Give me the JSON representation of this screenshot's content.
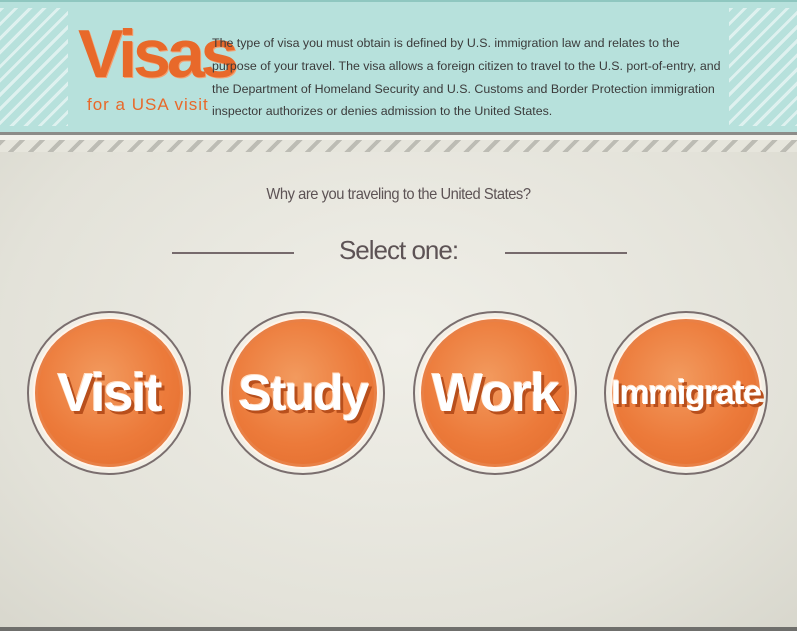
{
  "header": {
    "logo_title": "Visas",
    "logo_subtitle": "for a USA visit",
    "intro": "The type of visa you must obtain is defined by U.S. immigration law and relates to the purpose of your travel. The visa allows a foreign citizen to travel to the U.S. port-of-entry, and the Department of Homeland Security and U.S. Customs and Border Protection immigration inspector authorizes or denies admission to the United States."
  },
  "main": {
    "question": "Why are you traveling to the United States?",
    "select_label": "Select one:",
    "options": [
      {
        "label": "Visit"
      },
      {
        "label": "Study"
      },
      {
        "label": "Work"
      },
      {
        "label": "Immigrate"
      }
    ]
  },
  "colors": {
    "header_bg": "#b7e1dc",
    "accent_orange": "#ec7a3a",
    "text_dark": "#5d5355",
    "page_bg": "#e6e5dc"
  }
}
